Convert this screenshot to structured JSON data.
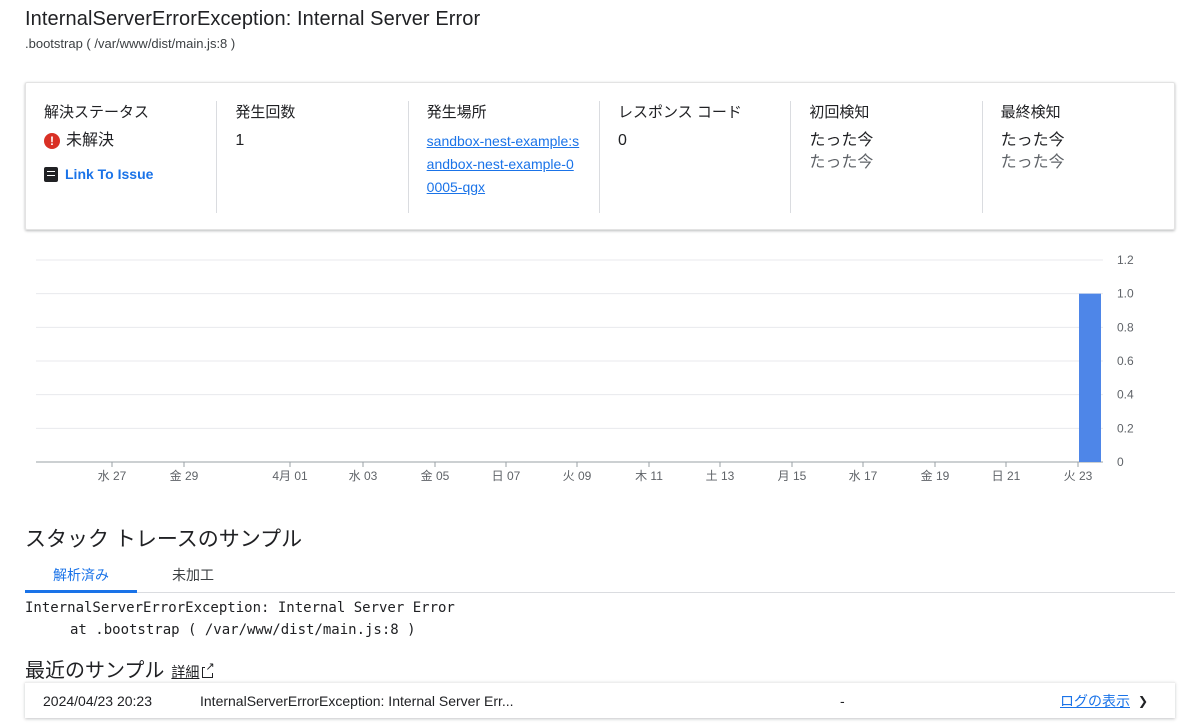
{
  "header": {
    "title": "InternalServerErrorException: Internal Server Error",
    "subtitle": ".bootstrap ( /var/www/dist/main.js:8 )"
  },
  "summary": {
    "status": {
      "label": "解決ステータス",
      "value": "未解決",
      "link_label": "Link To Issue"
    },
    "count": {
      "label": "発生回数",
      "value": "1"
    },
    "location": {
      "label": "発生場所",
      "value": "sandbox-nest-example:sandbox-nest-example-00005-qgx"
    },
    "response": {
      "label": "レスポンス コード",
      "value": "0"
    },
    "first_seen": {
      "label": "初回検知",
      "value": "たった今",
      "sub": "たった今"
    },
    "last_seen": {
      "label": "最終検知",
      "value": "たった今",
      "sub": "たった今"
    }
  },
  "chart_data": {
    "type": "bar",
    "categories": [
      "水 27",
      "金 29",
      "4月 01",
      "水 03",
      "金 05",
      "日 07",
      "火 09",
      "木 11",
      "土 13",
      "月 15",
      "水 17",
      "金 19",
      "日 21",
      "火 23"
    ],
    "values": [
      0,
      0,
      0,
      0,
      0,
      0,
      0,
      0,
      0,
      0,
      0,
      0,
      0,
      1
    ],
    "ylim": [
      0,
      1.2
    ],
    "yticks": [
      "0",
      "0.2",
      "0.4",
      "0.6",
      "0.8",
      "1.0",
      "1.2"
    ],
    "ylabel": "",
    "xlabel": "",
    "color": "#4e86e8",
    "grid": true
  },
  "stack": {
    "heading": "スタック トレースのサンプル",
    "tabs": [
      "解析済み",
      "未加工"
    ],
    "line1": "InternalServerErrorException: Internal Server Error",
    "line2": "at .bootstrap ( /var/www/dist/main.js:8 )"
  },
  "recent": {
    "heading": "最近のサンプル",
    "details_label": "詳細",
    "rows": [
      {
        "date": "2024/04/23 20:23",
        "message": "InternalServerErrorException: Internal Server Err...",
        "dash": "-",
        "logs_label": "ログの表示"
      }
    ]
  }
}
